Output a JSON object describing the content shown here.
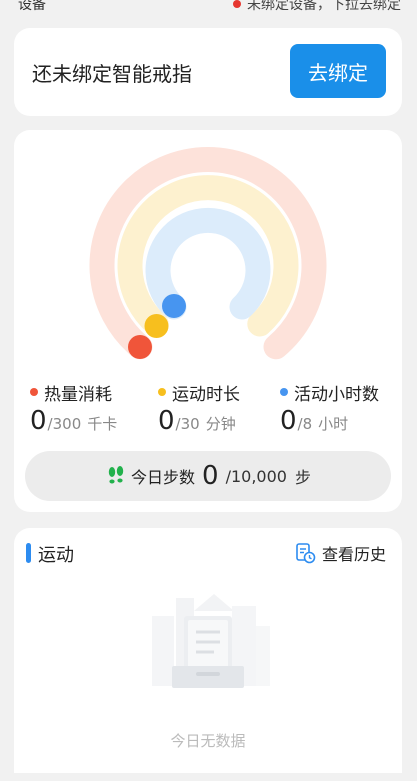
{
  "status": {
    "left_text": "设备",
    "right_text": "未绑定设备，下拉去绑定"
  },
  "bind_card": {
    "title": "还未绑定智能戒指",
    "button": "去绑定"
  },
  "rings": {
    "calories": {
      "label": "热量消耗",
      "value": "0",
      "goal": "/300",
      "unit": "千卡",
      "color": "#f0553a",
      "track": "#fde2da",
      "progress": 0
    },
    "exercise": {
      "label": "运动时长",
      "value": "0",
      "goal": "/30",
      "unit": "分钟",
      "color": "#f7bf1e",
      "track": "#fdf1cf",
      "progress": 0
    },
    "activity": {
      "label": "活动小时数",
      "value": "0",
      "goal": "/8",
      "unit": "小时",
      "color": "#4795f0",
      "track": "#dcecfb",
      "progress": 0
    }
  },
  "steps": {
    "label": "今日步数",
    "value": "0",
    "goal": "/10,000",
    "unit": "步",
    "icon": "footprints-icon",
    "icon_color": "#22b14c"
  },
  "sport": {
    "title": "运动",
    "history_label": "查看历史",
    "empty_text": "今日无数据"
  }
}
